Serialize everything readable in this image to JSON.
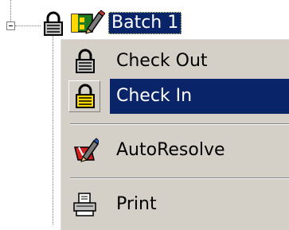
{
  "tree": {
    "node_label": "Batch 1",
    "icons": [
      "lock-icon",
      "batch-flag-icon"
    ]
  },
  "context_menu": {
    "items": [
      {
        "label": "Check Out",
        "icon": "lock-icon"
      },
      {
        "label": "Check In",
        "icon": "lock-icon",
        "selected": true
      },
      {
        "label": "AutoResolve",
        "icon": "autoresolve-icon"
      },
      {
        "label": "Print",
        "icon": "printer-icon"
      }
    ]
  },
  "colors": {
    "selection": "#0a246a",
    "menu_face": "#d4d0c8"
  }
}
